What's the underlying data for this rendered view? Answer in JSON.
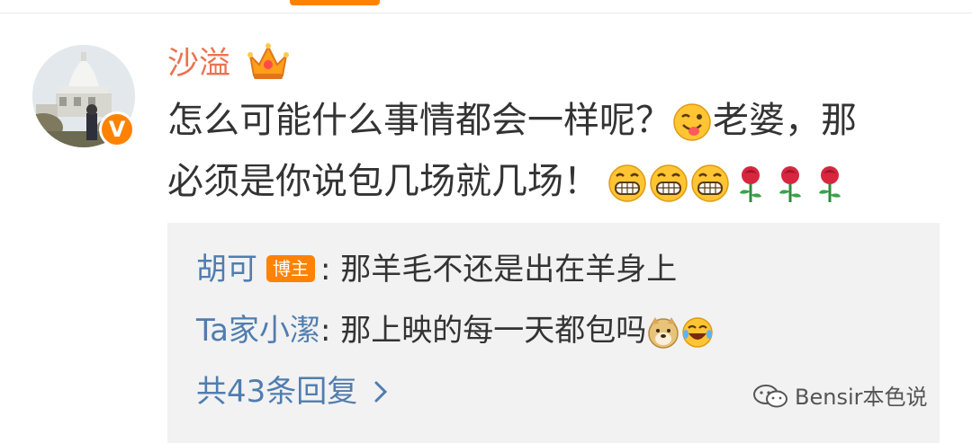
{
  "comment": {
    "username": "沙溢",
    "user_badges": [
      "vip-crown-icon",
      "verified-v-badge"
    ],
    "verified_badge_text": "V",
    "text_line1": "怎么可能什么事情都会一样呢？",
    "emoji_1": "tongue-wink-emoji",
    "text_line1b": "老婆，那",
    "text_line2": "必须是你说包几场就几场！",
    "trailing_emojis": [
      "grin-emoji",
      "grin-emoji",
      "grin-emoji",
      "rose-emoji",
      "rose-emoji",
      "rose-emoji"
    ]
  },
  "replies": [
    {
      "name": "胡可",
      "badge": "博主",
      "separator": ":",
      "text": "那羊毛不还是出在羊身上",
      "emojis": []
    },
    {
      "name": "Ta家小潔",
      "separator": ":",
      "text": "那上映的每一天都包吗",
      "emojis": [
        "doge-emoji",
        "laugh-tears-emoji"
      ]
    }
  ],
  "more_replies_label": "共43条回复",
  "watermark": "Bensir本色说",
  "colors": {
    "accent": "#ff8200",
    "username": "#eb7350",
    "link": "#507daf",
    "text": "#333333",
    "reply_bg": "#f2f2f2"
  }
}
